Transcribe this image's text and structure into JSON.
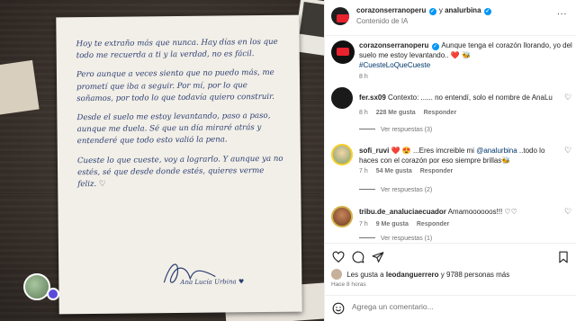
{
  "header": {
    "user1": "corazonserranoperu",
    "joiner": "y",
    "user2": "analurbina",
    "subtitle": "Contenido de IA",
    "more": "..."
  },
  "caption": {
    "user": "corazonserranoperu",
    "text": "Aunque tenga el corazón llorando, yo del suelo me estoy levantando.. ❤️ 🐝",
    "hashtag": "#CuesteLoQueCueste",
    "time": "8 h"
  },
  "comments": [
    {
      "user": "fer.sx09",
      "text": "Contexto: ...... no entendí, solo el nombre de AnaLu",
      "time": "8 h",
      "likes": "228 Me gusta",
      "reply": "Responder",
      "replies": "Ver respuestas (3)"
    },
    {
      "user": "sofi_ruvi",
      "text": "❤️ 😍 ...Eres imcreible mi",
      "mention": "@analurbina",
      "text2": "..todo lo haces con el corazón por eso siempre brillas🐝",
      "time": "7 h",
      "likes": "54 Me gusta",
      "reply": "Responder",
      "replies": "Ver respuestas (2)"
    },
    {
      "user": "tribu.de_analuciaecuador",
      "text": "Amamoooooos!!! ♡♡",
      "time": "7 h",
      "likes": "9 Me gusta",
      "reply": "Responder",
      "replies": "Ver respuestas (1)"
    }
  ],
  "likes": {
    "prefix": "Les gusta a",
    "user": "leodanguerrero",
    "suffix": "y 9788 personas más",
    "ago": "Hace 8 horas"
  },
  "add_comment": {
    "placeholder": "Agrega un comentario..."
  },
  "letter": {
    "p1": "Hoy te extraño más que nunca. Hay días en los que todo me recuerda a ti y la verdad, no es fácil.",
    "p2": "Pero aunque a veces siento que no puedo más, me prometí que iba a seguir. Por mí, por lo que soñamos, por todo lo que todavía quiero construir.",
    "p3": "Desde el suelo me estoy levantando, paso a paso, aunque me duela. Sé que un día miraré atrás y entenderé que todo esto valió la pena.",
    "p4": "Cueste lo que cueste, voy a lograrlo. Y aunque ya no estés, sé que desde donde estés, quieres verme feliz. ♡",
    "signature": "Ana Lucía Urbina ♥"
  },
  "colors": {
    "link": "#00376b",
    "verified": "#0095f6",
    "heart": "#ed2d42",
    "ink": "#2d3f72"
  }
}
